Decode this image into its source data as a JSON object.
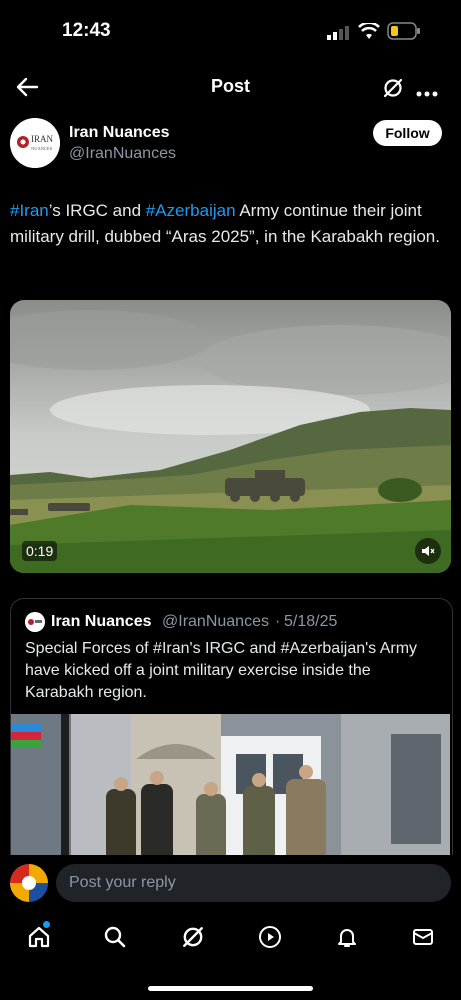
{
  "status_bar": {
    "time": "12:43"
  },
  "header": {
    "title": "Post"
  },
  "author": {
    "name": "Iran Nuances",
    "handle": "@IranNuances",
    "avatar_text_top": "IRAN",
    "avatar_text_bottom": "NUANCES"
  },
  "follow_label": "Follow",
  "post": {
    "tag_iran": "#Iran",
    "text_1": "’s IRGC and ",
    "tag_azerbaijan": "#Azerbaijan",
    "text_2": " Army continue their joint military drill, dubbed “Aras 2025”, in the Karabakh region."
  },
  "video": {
    "time": "0:19"
  },
  "quote": {
    "name": "Iran Nuances",
    "handle": "@IranNuances",
    "separator": "·",
    "date": "5/18/25",
    "text": "Special Forces of #Iran's IRGC and #Azerbaijan's Army have kicked off a joint military exercise inside the Karabakh region."
  },
  "reply": {
    "placeholder": "Post your reply"
  },
  "colors": {
    "accent": "#1d9bf0",
    "background": "#000000",
    "muted": "#8b98a5"
  },
  "icons": [
    "back-arrow-icon",
    "grok-icon",
    "more-icon",
    "mute-icon",
    "home-icon",
    "search-icon",
    "grok-icon",
    "video-play-icon",
    "bell-icon",
    "mail-icon"
  ]
}
